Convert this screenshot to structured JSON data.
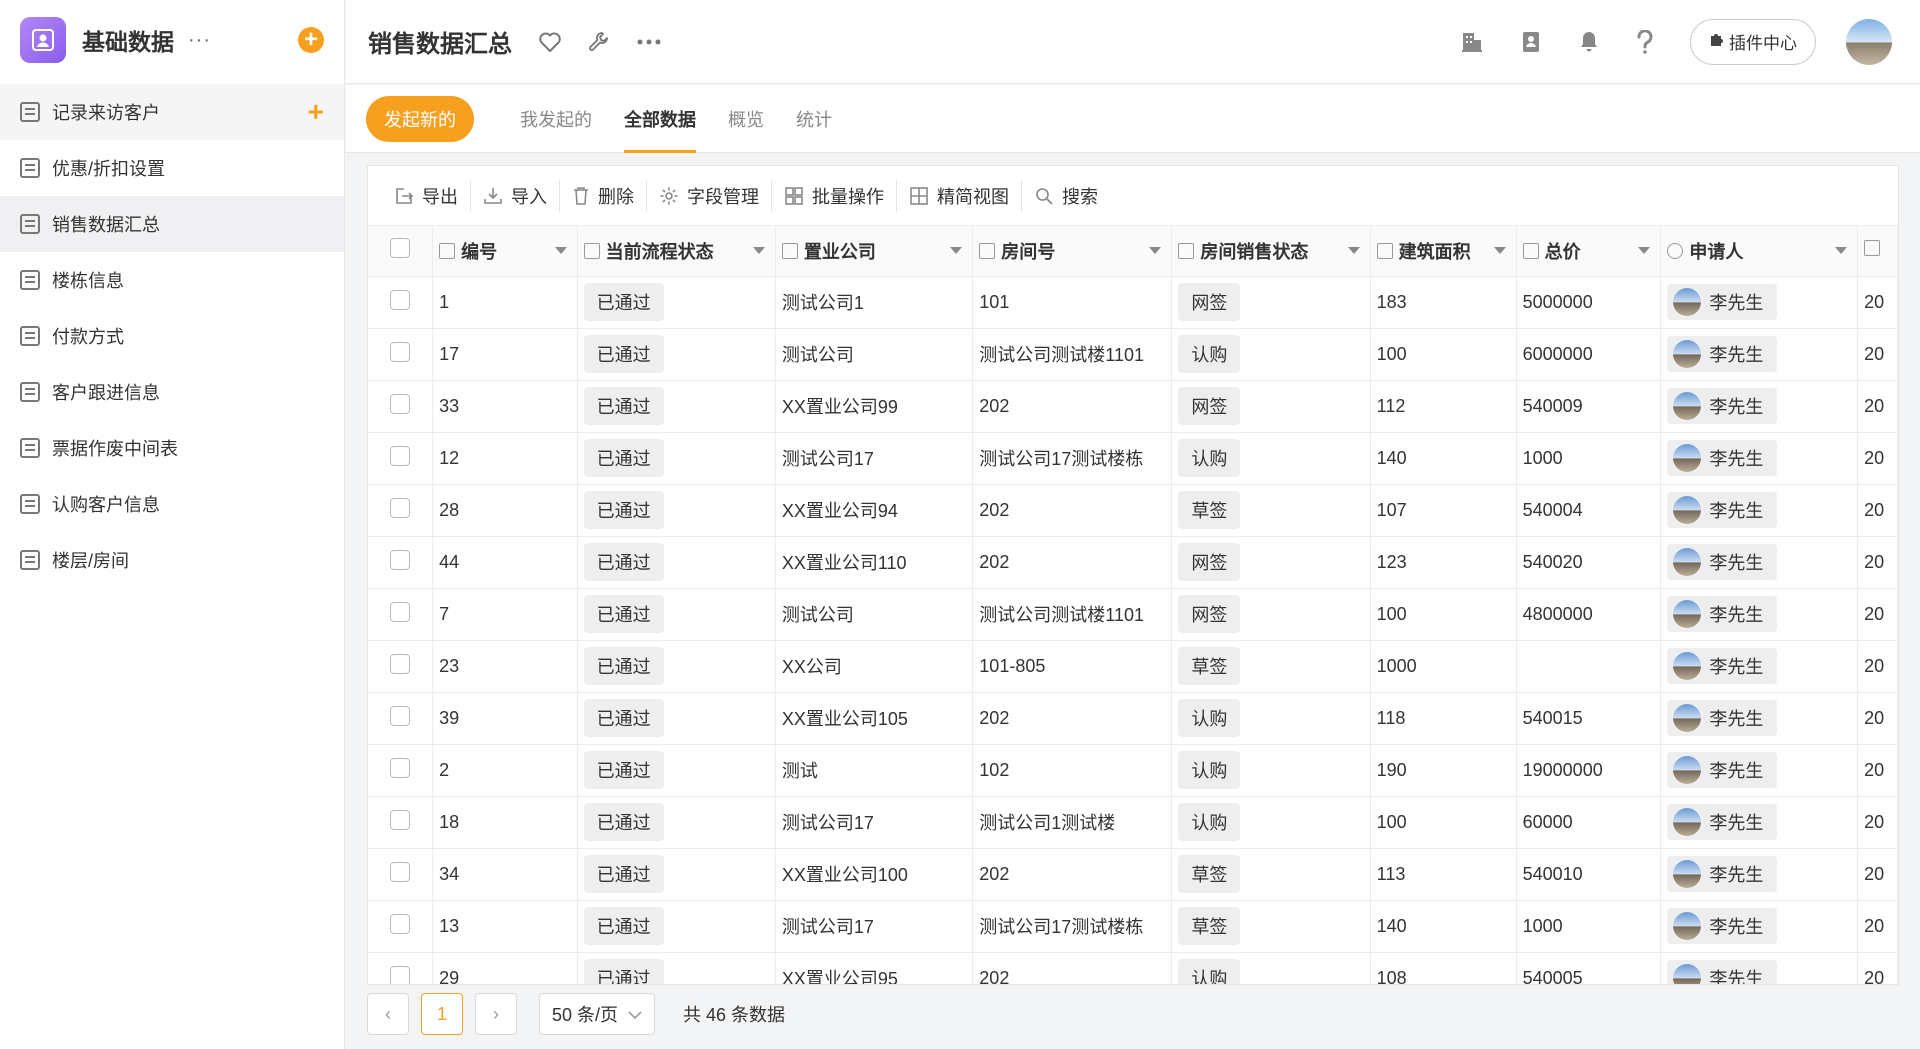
{
  "app": {
    "title": "基础数据",
    "more": "···",
    "add": "+"
  },
  "sidebar": {
    "items": [
      {
        "label": "记录来访客户"
      },
      {
        "label": "优惠/折扣设置"
      },
      {
        "label": "销售数据汇总"
      },
      {
        "label": "楼栋信息"
      },
      {
        "label": "付款方式"
      },
      {
        "label": "客户跟进信息"
      },
      {
        "label": "票据作废中间表"
      },
      {
        "label": "认购客户信息"
      },
      {
        "label": "楼层/房间"
      }
    ],
    "add_icon": "+"
  },
  "header": {
    "title": "销售数据汇总",
    "plugin_label": "插件中心",
    "icons": [
      "heart-icon",
      "wrench-icon",
      "more-icon",
      "building-icon",
      "contacts-icon",
      "bell-icon",
      "help-icon",
      "puzzle-icon"
    ]
  },
  "tabs": {
    "new_label": "发起新的",
    "items": [
      {
        "label": "我发起的"
      },
      {
        "label": "全部数据"
      },
      {
        "label": "概览"
      },
      {
        "label": "统计"
      }
    ]
  },
  "toolbar": {
    "items": [
      {
        "label": "导出"
      },
      {
        "label": "导入"
      },
      {
        "label": "删除"
      },
      {
        "label": "字段管理"
      },
      {
        "label": "批量操作"
      },
      {
        "label": "精简视图"
      },
      {
        "label": "搜索"
      }
    ]
  },
  "table": {
    "columns": [
      "编号",
      "当前流程状态",
      "置业公司",
      "房间号",
      "房间销售状态",
      "建筑面积",
      "总价",
      "申请人"
    ],
    "overflow_text": "20",
    "rows": [
      {
        "id": "1",
        "flow": "已通过",
        "company": "测试公司1",
        "room": "101",
        "sale": "网签",
        "area": "183",
        "price": "5000000",
        "applicant": "李先生"
      },
      {
        "id": "17",
        "flow": "已通过",
        "company": "测试公司",
        "room": "测试公司测试楼1101",
        "sale": "认购",
        "area": "100",
        "price": "6000000",
        "applicant": "李先生"
      },
      {
        "id": "33",
        "flow": "已通过",
        "company": "XX置业公司99",
        "room": "202",
        "sale": "网签",
        "area": "112",
        "price": "540009",
        "applicant": "李先生"
      },
      {
        "id": "12",
        "flow": "已通过",
        "company": "测试公司17",
        "room": "测试公司17测试楼栋",
        "sale": "认购",
        "area": "140",
        "price": "1000",
        "applicant": "李先生"
      },
      {
        "id": "28",
        "flow": "已通过",
        "company": "XX置业公司94",
        "room": "202",
        "sale": "草签",
        "area": "107",
        "price": "540004",
        "applicant": "李先生"
      },
      {
        "id": "44",
        "flow": "已通过",
        "company": "XX置业公司110",
        "room": "202",
        "sale": "网签",
        "area": "123",
        "price": "540020",
        "applicant": "李先生"
      },
      {
        "id": "7",
        "flow": "已通过",
        "company": "测试公司",
        "room": "测试公司测试楼1101",
        "sale": "网签",
        "area": "100",
        "price": "4800000",
        "applicant": "李先生"
      },
      {
        "id": "23",
        "flow": "已通过",
        "company": "XX公司",
        "room": "101-805",
        "sale": "草签",
        "area": "1000",
        "price": "",
        "applicant": "李先生"
      },
      {
        "id": "39",
        "flow": "已通过",
        "company": "XX置业公司105",
        "room": "202",
        "sale": "认购",
        "area": "118",
        "price": "540015",
        "applicant": "李先生"
      },
      {
        "id": "2",
        "flow": "已通过",
        "company": "测试",
        "room": "102",
        "sale": "认购",
        "area": "190",
        "price": "19000000",
        "applicant": "李先生"
      },
      {
        "id": "18",
        "flow": "已通过",
        "company": "测试公司17",
        "room": "测试公司1测试楼",
        "sale": "认购",
        "area": "100",
        "price": "60000",
        "applicant": "李先生"
      },
      {
        "id": "34",
        "flow": "已通过",
        "company": "XX置业公司100",
        "room": "202",
        "sale": "草签",
        "area": "113",
        "price": "540010",
        "applicant": "李先生"
      },
      {
        "id": "13",
        "flow": "已通过",
        "company": "测试公司17",
        "room": "测试公司17测试楼栋",
        "sale": "草签",
        "area": "140",
        "price": "1000",
        "applicant": "李先生"
      },
      {
        "id": "29",
        "flow": "已通过",
        "company": "XX置业公司95",
        "room": "202",
        "sale": "认购",
        "area": "108",
        "price": "540005",
        "applicant": "李先生"
      }
    ]
  },
  "pager": {
    "prev": "‹",
    "current": "1",
    "next": "›",
    "page_size": "50 条/页",
    "total": "共 46 条数据"
  },
  "colors": {
    "accent": "#f7a01f",
    "logo": "#9b6cf2"
  }
}
